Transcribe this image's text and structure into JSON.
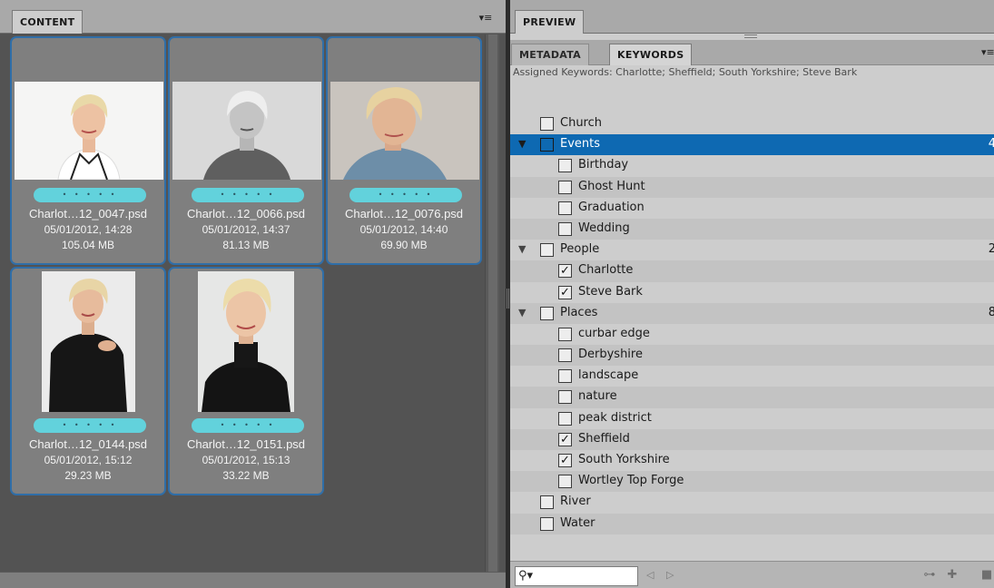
{
  "content_panel": {
    "tab_label": "CONTENT",
    "menu_icon": "panel-menu-icon",
    "thumbnails": [
      {
        "name": "Charlot…12_0047.psd",
        "date": "05/01/2012, 14:28",
        "size": "105.04 MB",
        "rating": "• • • • •"
      },
      {
        "name": "Charlot…12_0066.psd",
        "date": "05/01/2012, 14:37",
        "size": "81.13 MB",
        "rating": "• • • • •"
      },
      {
        "name": "Charlot…12_0076.psd",
        "date": "05/01/2012, 14:40",
        "size": "69.90 MB",
        "rating": "• • • • •"
      },
      {
        "name": "Charlot…12_0144.psd",
        "date": "05/01/2012, 15:12",
        "size": "29.23 MB",
        "rating": "• • • • •"
      },
      {
        "name": "Charlot…12_0151.psd",
        "date": "05/01/2012, 15:13",
        "size": "33.22 MB",
        "rating": "• • • • •"
      }
    ]
  },
  "preview_panel": {
    "tab_label": "PREVIEW"
  },
  "keywords_panel": {
    "tabs": {
      "metadata": "METADATA",
      "keywords": "KEYWORDS"
    },
    "assigned": "Assigned Keywords: Charlotte; Sheffield; South Yorkshire; Steve Bark",
    "rows": [
      {
        "label": "Church",
        "checked": false,
        "level": 0
      },
      {
        "label": "Events",
        "checked": false,
        "level": 0,
        "expanded": true,
        "count": "4",
        "selected": true
      },
      {
        "label": "Birthday",
        "checked": false,
        "level": 1
      },
      {
        "label": "Ghost Hunt",
        "checked": false,
        "level": 1
      },
      {
        "label": "Graduation",
        "checked": false,
        "level": 1
      },
      {
        "label": "Wedding",
        "checked": false,
        "level": 1
      },
      {
        "label": "People",
        "checked": false,
        "level": 0,
        "expanded": true,
        "count": "2"
      },
      {
        "label": "Charlotte",
        "checked": true,
        "level": 1
      },
      {
        "label": "Steve Bark",
        "checked": true,
        "level": 1
      },
      {
        "label": "Places",
        "checked": false,
        "level": 0,
        "expanded": true,
        "count": "8"
      },
      {
        "label": "curbar edge",
        "checked": false,
        "level": 1
      },
      {
        "label": "Derbyshire",
        "checked": false,
        "level": 1
      },
      {
        "label": "landscape",
        "checked": false,
        "level": 1
      },
      {
        "label": "nature",
        "checked": false,
        "level": 1
      },
      {
        "label": "peak district",
        "checked": false,
        "level": 1
      },
      {
        "label": "Sheffield",
        "checked": true,
        "level": 1
      },
      {
        "label": "South Yorkshire",
        "checked": true,
        "level": 1
      },
      {
        "label": "Wortley Top Forge",
        "checked": false,
        "level": 1
      },
      {
        "label": "River",
        "checked": false,
        "level": 0
      },
      {
        "label": "Water",
        "checked": false,
        "level": 0
      }
    ],
    "search": {
      "value": "",
      "icon": "search-icon"
    },
    "footer_icons": [
      "previous-arrow-icon",
      "next-arrow-icon",
      "new-sub-keyword-icon",
      "new-keyword-icon",
      "delete-keyword-icon"
    ]
  },
  "colors": {
    "selection": "#0e69b2",
    "rating_bar": "#62d2dc",
    "thumb_border": "#2f6ea8",
    "content_bg": "#535353",
    "keywords_bg": "#cdcdcd"
  }
}
